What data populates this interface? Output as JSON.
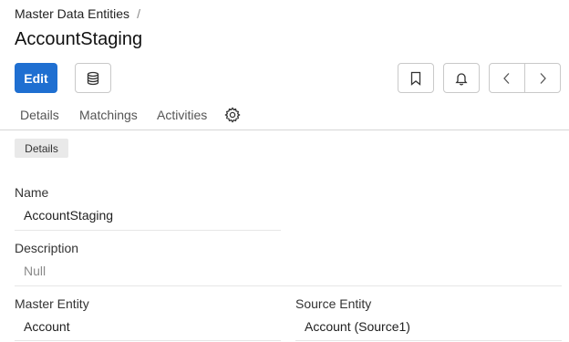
{
  "breadcrumb": {
    "parent": "Master Data Entities",
    "separator": "/"
  },
  "page": {
    "title": "AccountStaging"
  },
  "toolbar": {
    "edit_label": "Edit",
    "database_icon": "database-icon",
    "bookmark_icon": "bookmark-icon",
    "bell_icon": "bell-icon",
    "prev_icon": "chevron-left-icon",
    "next_icon": "chevron-right-icon",
    "primary_color": "#1f6fd1"
  },
  "tabs": [
    {
      "label": "Details"
    },
    {
      "label": "Matchings"
    },
    {
      "label": "Activities"
    }
  ],
  "section": {
    "label": "Details"
  },
  "fields": {
    "name": {
      "label": "Name",
      "value": "AccountStaging"
    },
    "description": {
      "label": "Description",
      "value": "Null"
    },
    "master_entity": {
      "label": "Master Entity",
      "value": "Account"
    },
    "source_entity": {
      "label": "Source Entity",
      "value": "Account (Source1)"
    }
  }
}
